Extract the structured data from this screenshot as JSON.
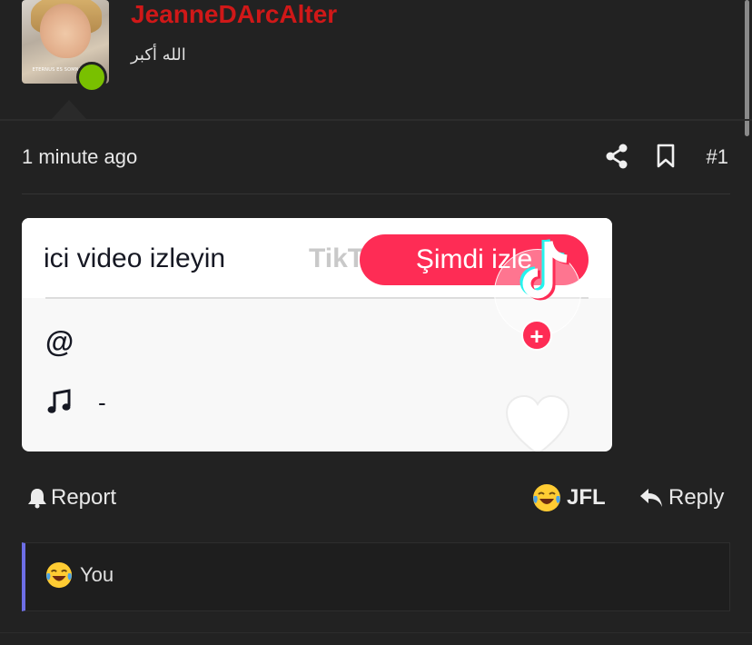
{
  "user": {
    "name": "JeanneDArcAlter",
    "title": "الله أكبر",
    "avatar_caption": "ETERNUS ES SOMNI DECRE",
    "online": true
  },
  "post": {
    "timestamp": "1 minute ago",
    "number": "#1"
  },
  "embed": {
    "promo_text": "ici video izleyin",
    "brand_faded": "TikT",
    "watch_button": "Şimdi izle",
    "at_sign": "@",
    "music_text": "-",
    "logo_plus": "+"
  },
  "actions": {
    "report": "Report",
    "reaction_label": "JFL",
    "reply": "Reply"
  },
  "reactions": {
    "summary": "You"
  },
  "colors": {
    "username": "#d01818",
    "online": "#79c000",
    "tiktok_red": "#fe2c55",
    "reactions_accent": "#6d6ee6"
  },
  "icons": [
    "share-icon",
    "bookmark-icon",
    "bell-icon",
    "reply-icon",
    "music-note-icon",
    "heart-icon",
    "tiktok-logo-icon",
    "joy-emoji-icon"
  ]
}
